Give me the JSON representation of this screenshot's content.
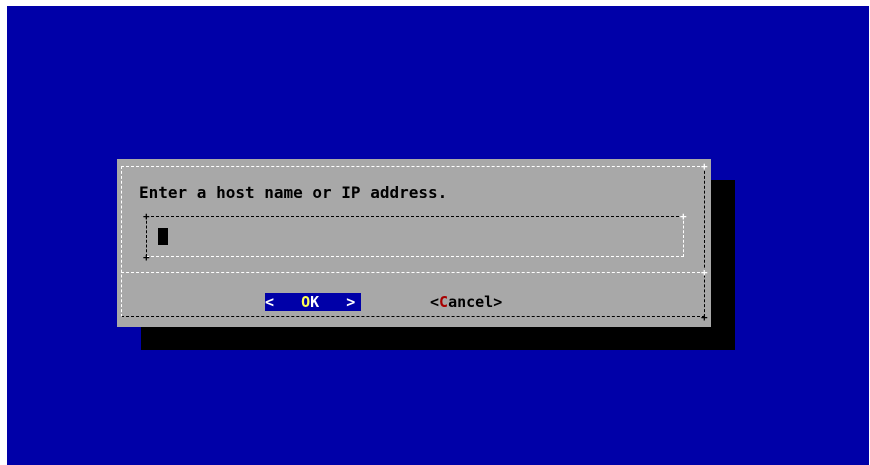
{
  "dialog": {
    "prompt": "Enter a host name or IP address.",
    "input": {
      "value": "",
      "placeholder": ""
    },
    "buttons": {
      "ok": {
        "left_bracket": "< ",
        "hotkey": "O",
        "rest": "K",
        "right_bracket": " >"
      },
      "cancel": {
        "left_bracket": "<",
        "hotkey": "C",
        "rest": "ancel",
        "right_bracket": ">"
      }
    }
  },
  "colors": {
    "screen_background": "#0000a8",
    "dialog_background": "#a8a8a8",
    "selected_button": "#0000a8",
    "hotkey_selected": "#ffff54",
    "hotkey_unselected": "#a80000",
    "shadow": "#000000"
  }
}
